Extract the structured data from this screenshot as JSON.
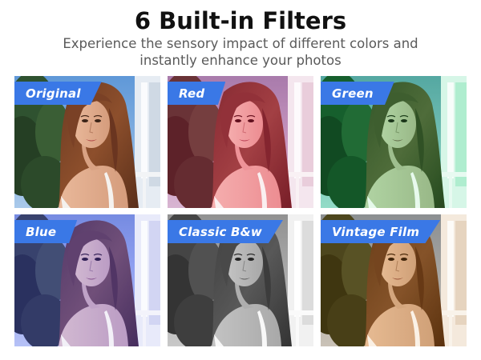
{
  "header": {
    "title": "6 Built-in Filters",
    "subtitle": "Experience the sensory impact of different colors and instantly enhance your photos"
  },
  "filters": [
    {
      "label": "Original",
      "tint": "#00000000",
      "gray": false
    },
    {
      "label": "Red",
      "tint": "#e7668a",
      "gray": false
    },
    {
      "label": "Green",
      "tint": "#7be3a4",
      "gray": false
    },
    {
      "label": "Blue",
      "tint": "#8f86ef",
      "gray": false
    },
    {
      "label": "Classic B&w",
      "tint": "#00000000",
      "gray": true
    },
    {
      "label": "Vintage Film",
      "tint": "#c8a070",
      "gray": false
    }
  ],
  "colors": {
    "badge": "#3a78e6",
    "title": "#111111",
    "subtitle": "#5a5a5a"
  }
}
